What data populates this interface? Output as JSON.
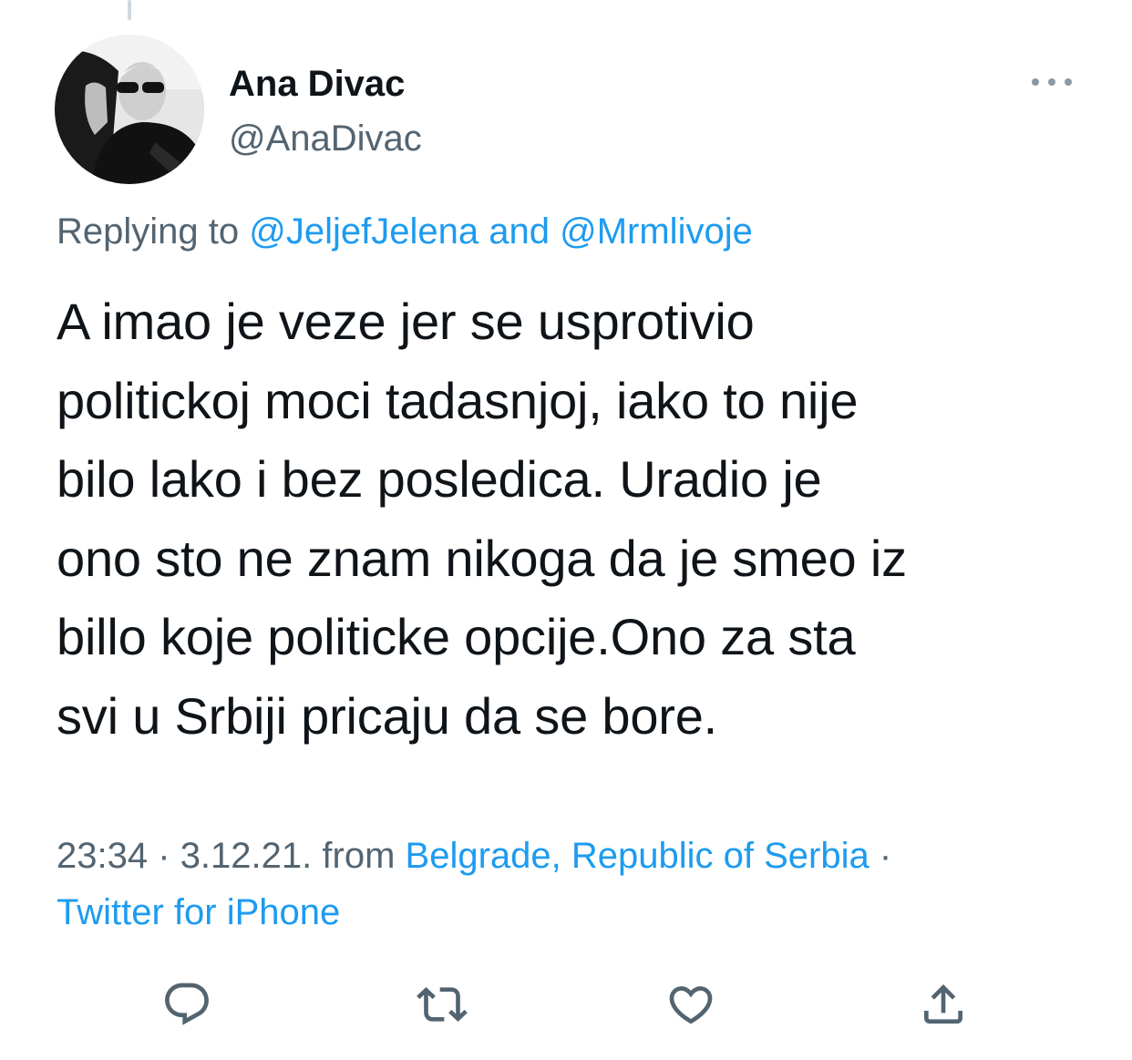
{
  "author": {
    "name": "Ana Divac",
    "handle": "@AnaDivac"
  },
  "replying": {
    "prefix": "Replying to",
    "mention1": "@JeljefJelena",
    "and": "and",
    "mention2": "@Mrmlivoje"
  },
  "tweet": {
    "lines": [
      "A imao je veze jer se usprotivio",
      "politickoj moci tadasnjoj, iako to nije",
      "bilo lako i bez posledica. Uradio je",
      "ono sto ne znam nikoga da je smeo iz",
      "billo koje politicke opcije.Ono za sta",
      "svi u Srbiji pricaju da se bore."
    ]
  },
  "meta": {
    "time": "23:34",
    "sep1": "·",
    "date": "3.12.21.",
    "from": "from",
    "location": "Belgrade, Republic of Serbia",
    "sep2": "·",
    "source": "Twitter for iPhone"
  },
  "icons": {
    "more": "more-icon",
    "reply": "reply-icon",
    "retweet": "retweet-icon",
    "like": "like-icon",
    "share": "share-icon"
  },
  "colors": {
    "text": "#0f1419",
    "secondary": "#536471",
    "link": "#1d9bf0"
  }
}
